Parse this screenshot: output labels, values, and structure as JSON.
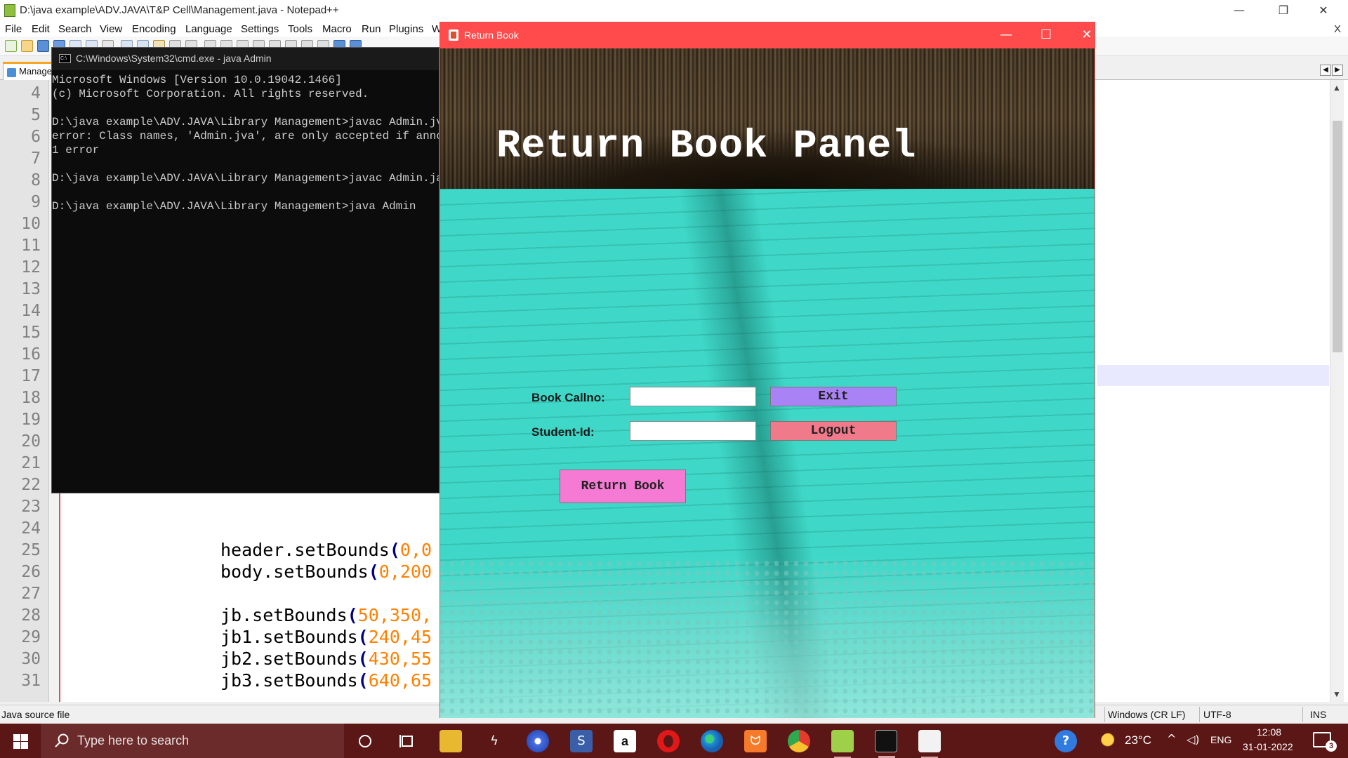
{
  "notepad": {
    "title": "D:\\java example\\ADV.JAVA\\T&P Cell\\Management.java - Notepad++",
    "menus": [
      "File",
      "Edit",
      "Search",
      "View",
      "Encoding",
      "Language",
      "Settings",
      "Tools",
      "Macro",
      "Run",
      "Plugins",
      "W"
    ],
    "close_doc": "X",
    "tab_label": "Manage",
    "tab_nav_left": "◀",
    "tab_nav_right": "▶",
    "line_numbers": [
      "4",
      "5",
      "6",
      "7",
      "8",
      "9",
      "10",
      "11",
      "12",
      "13",
      "14",
      "15",
      "16",
      "17",
      "18",
      "19",
      "20",
      "21",
      "22",
      "23",
      "24",
      "25",
      "26",
      "27",
      "28",
      "29",
      "30",
      "31"
    ],
    "code": [
      {
        "text": "header.setBounds",
        "paren": "(",
        "nums": "0,0"
      },
      {
        "text": "body.setBounds",
        "paren": "(",
        "nums": "0,200"
      },
      {
        "text": "jb.setBounds",
        "paren": "(",
        "nums": "50,350,"
      },
      {
        "text": "jb1.setBounds",
        "paren": "(",
        "nums": "240,45"
      },
      {
        "text": "jb2.setBounds",
        "paren": "(",
        "nums": "430,55"
      },
      {
        "text": "jb3.setBounds",
        "paren": "(",
        "nums": "640,65"
      }
    ],
    "status": {
      "file_type": "Java source file",
      "eol": "Windows (CR LF)",
      "encoding": "UTF-8",
      "mode": "INS"
    }
  },
  "cmd": {
    "title": "C:\\Windows\\System32\\cmd.exe - java  Admin",
    "icon_text": "C:\\",
    "lines": [
      "Microsoft Windows [Version 10.0.19042.1466]",
      "(c) Microsoft Corporation. All rights reserved.",
      "",
      "D:\\java example\\ADV.JAVA\\Library Management>javac Admin.jva",
      "error: Class names, 'Admin.jva', are only accepted if annotati",
      "1 error",
      "",
      "D:\\java example\\ADV.JAVA\\Library Management>javac Admin.java",
      "",
      "D:\\java example\\ADV.JAVA\\Library Management>java Admin"
    ]
  },
  "return_book": {
    "window_title": "Return Book",
    "heading": "Return Book Panel",
    "fields": {
      "book_callno_label": "Book Callno:",
      "book_callno_value": "",
      "student_id_label": "Student-Id:",
      "student_id_value": ""
    },
    "buttons": {
      "exit": "Exit",
      "logout": "Logout",
      "return_book": "Return Book"
    },
    "colors": {
      "titlebar": "#ff4b4b",
      "exit_button": "#a983f5",
      "logout_button": "#f0798a",
      "return_button": "#f57ad4",
      "body_tint": "#3fd8c8"
    }
  },
  "taskbar": {
    "search_placeholder": "Type here to search",
    "temperature": "23°C",
    "language": "ENG",
    "time": "12:08",
    "date": "31-01-2022",
    "notification_count": "3",
    "amazon_label": "a",
    "apps": [
      "task-view",
      "file-explorer",
      "app-lightning",
      "chrome-alt",
      "sublime",
      "amazon",
      "opera",
      "edge",
      "xampp",
      "chrome",
      "notepad-plus-plus",
      "command-prompt",
      "java"
    ]
  }
}
